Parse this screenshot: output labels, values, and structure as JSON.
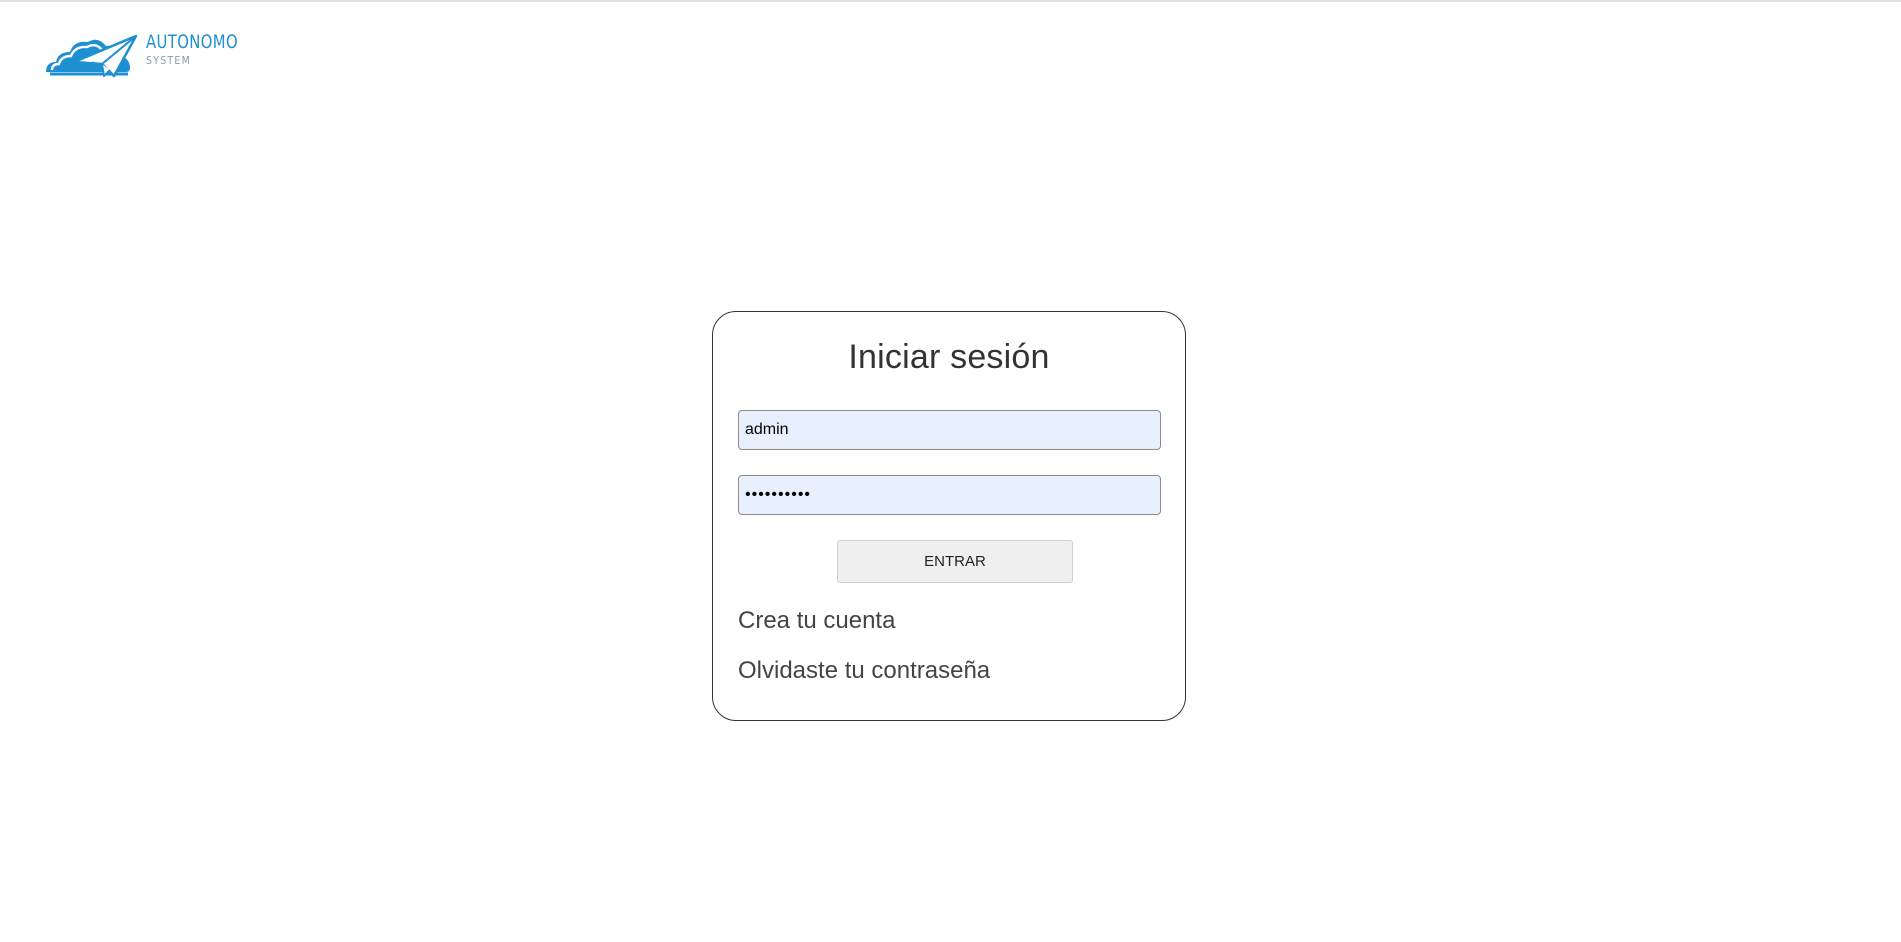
{
  "brand": {
    "name": "AUTONOMO",
    "subtitle": "SYSTEM",
    "color": "#1e8fd0",
    "subtitle_color": "#8a9aa5",
    "icon": "cloud-paper-plane-logo"
  },
  "login": {
    "title": "Iniciar sesión",
    "username_value": "admin",
    "password_value": "••••••••••",
    "submit_label": "ENTRAR",
    "create_account_label": "Crea tu cuenta",
    "forgot_password_label": "Olvidaste tu contraseña",
    "field_background": "#e8f0fe"
  }
}
